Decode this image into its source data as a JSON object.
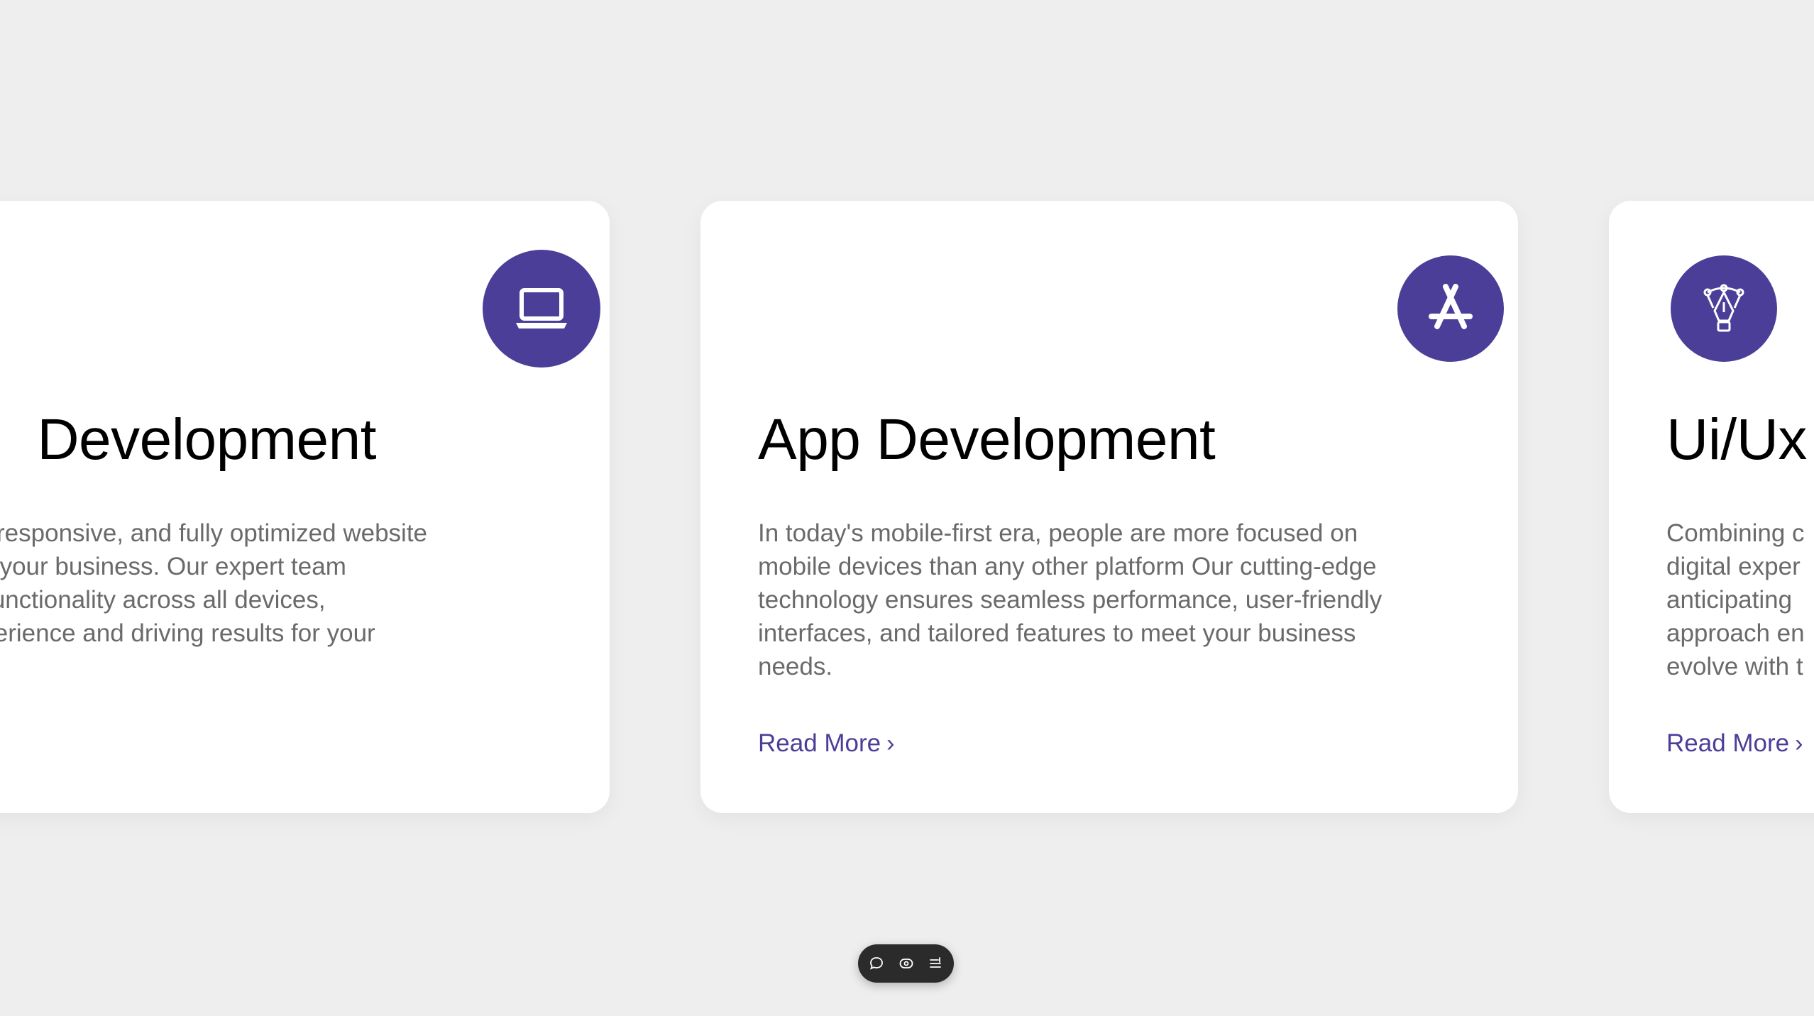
{
  "cards": [
    {
      "title": "Development",
      "icon": "laptop-icon",
      "description_lines": [
        "quality, responsive, and fully optimized website",
        "elevate your business. Our expert team",
        "mless functionality across all devices,",
        "ser experience and driving results for your"
      ]
    },
    {
      "title": "App Development",
      "icon": "app-store-icon",
      "description_lines": [
        "In today's mobile-first era, people are more focused on",
        "mobile devices than any other platform Our cutting-edge",
        "technology ensures seamless performance, user-friendly",
        "interfaces, and tailored features to meet your business",
        "needs."
      ],
      "read_more": "Read More",
      "chevron": "›"
    },
    {
      "title": "Ui/Ux",
      "icon": "pen-tool-icon",
      "description_lines": [
        "Combining c",
        "digital exper",
        "anticipating",
        "approach en",
        "evolve with t"
      ],
      "read_more": "Read More",
      "chevron": "›"
    }
  ],
  "toolbar": {
    "items": [
      "comment-icon",
      "eye-icon",
      "menu-icon"
    ]
  },
  "colors": {
    "accent": "#4b3e98",
    "background": "#eeeeee",
    "card": "#ffffff",
    "text": "#6a6a6a"
  }
}
